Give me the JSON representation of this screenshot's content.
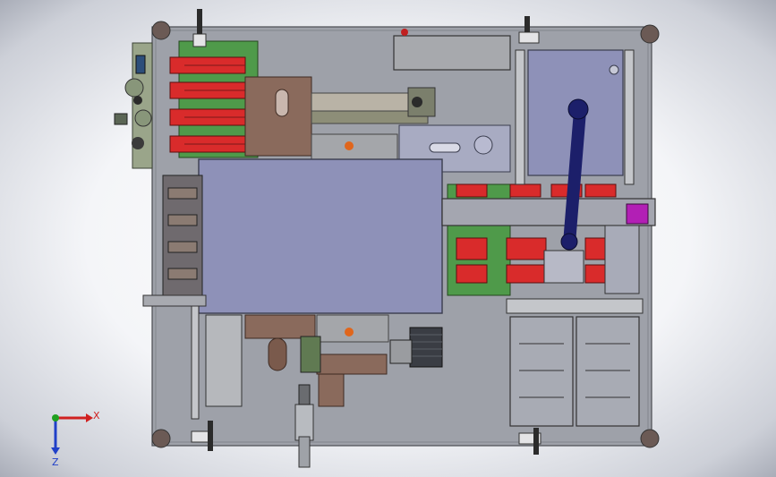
{
  "view": {
    "triad": {
      "x_label": "X",
      "z_label": "Z",
      "x_color": "#d02020",
      "y_color": "#20a020",
      "z_color": "#2040c8"
    }
  },
  "colors": {
    "plate": "#9ea1a9",
    "plate_edge": "#4a4c52",
    "cover": "#8e91b8",
    "cover_edge": "#3a3d4e",
    "red_part": "#d92b2b",
    "green_part": "#4f9a4a",
    "brown_part": "#8a6a5c",
    "arm": "#1c1f6a",
    "magenta": "#b21fb5",
    "orange_dot": "#e0661c",
    "motor": "#3a3d44"
  }
}
